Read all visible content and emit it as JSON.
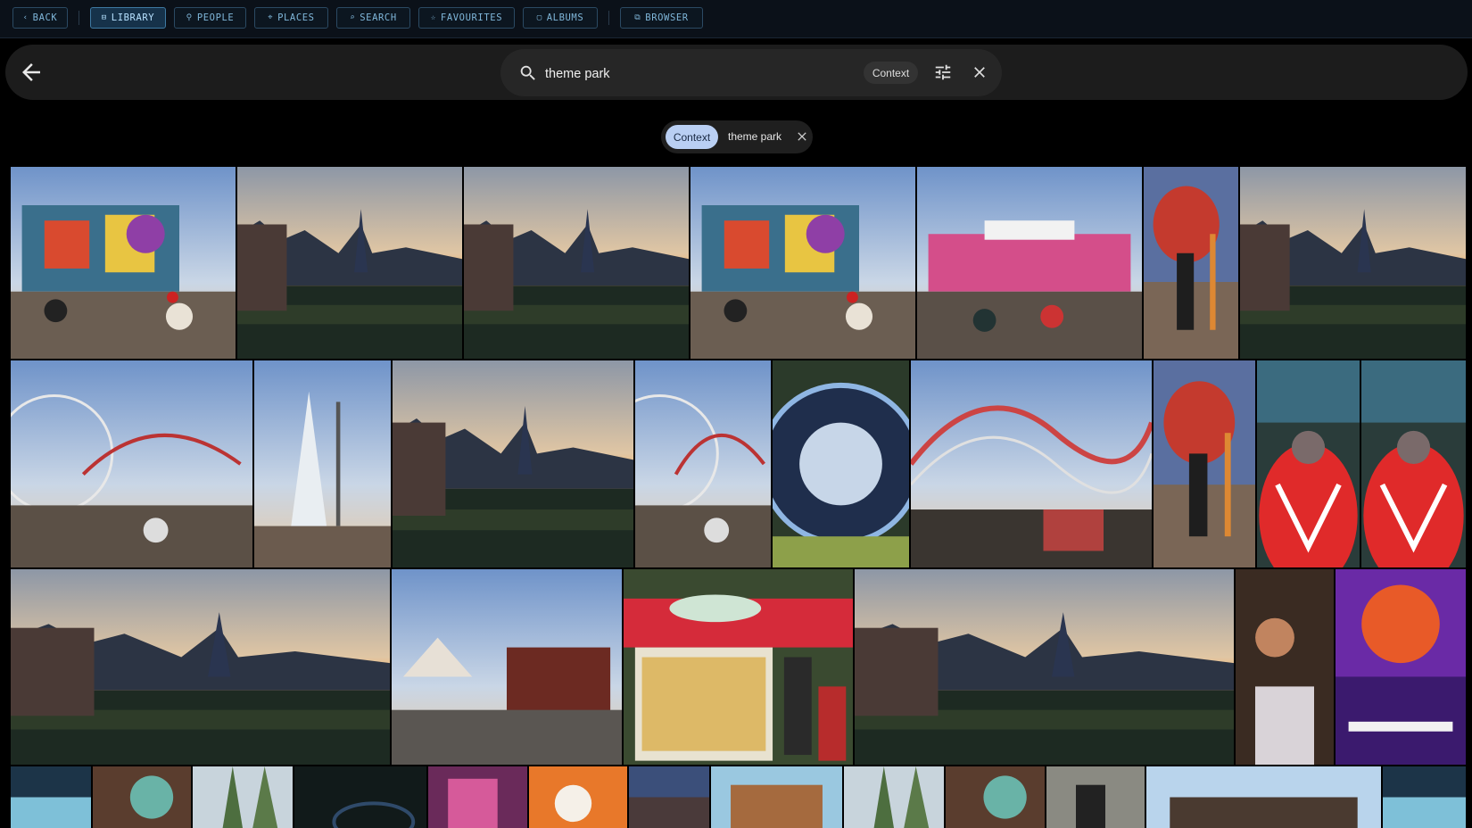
{
  "nav": {
    "buttons": [
      {
        "label": "BACK",
        "icon": "chevron-left-icon",
        "active": false
      },
      {
        "label": "LIBRARY",
        "icon": "library-icon",
        "active": true
      },
      {
        "label": "PEOPLE",
        "icon": "person-icon",
        "active": false
      },
      {
        "label": "PLACES",
        "icon": "pin-icon",
        "active": false
      },
      {
        "label": "SEARCH",
        "icon": "search-icon",
        "active": false
      },
      {
        "label": "FAVOURITES",
        "icon": "star-icon",
        "active": false
      },
      {
        "label": "ALBUMS",
        "icon": "album-icon",
        "active": false
      },
      {
        "label": "BROWSER",
        "icon": "external-link-icon",
        "active": false
      }
    ],
    "glyphs": [
      "‹",
      "⊟",
      "⚲",
      "⌖",
      "⌕",
      "☆",
      "▢",
      "⧉"
    ]
  },
  "search": {
    "query": "theme park",
    "context_label": "Context",
    "icons": [
      "back-arrow-icon",
      "search-icon",
      "tune-icon",
      "close-icon"
    ]
  },
  "filter": {
    "context_label": "Context",
    "term": "theme park",
    "remove_icon": "close-icon"
  },
  "colors": {
    "nav_bg": "#0b1119",
    "nav_accent": "#7fb6d9",
    "search_bg": "#1c1c1c",
    "chip_active": "#b9cff3",
    "page_bg": "#000000"
  },
  "photos": [
    {
      "subject": "fairground"
    },
    {
      "subject": "castle-lake"
    },
    {
      "subject": "castle-lake"
    },
    {
      "subject": "fairground"
    },
    {
      "subject": "fairground-ride"
    },
    {
      "subject": "person-figure"
    },
    {
      "subject": "castle-lake"
    },
    {
      "subject": "ferris-coaster"
    },
    {
      "subject": "tower"
    },
    {
      "subject": "castle-lake"
    },
    {
      "subject": "ferris-coaster"
    },
    {
      "subject": "blur-ride"
    },
    {
      "subject": "rollercoaster"
    },
    {
      "subject": "person-figure"
    },
    {
      "subject": "red-car"
    },
    {
      "subject": "red-car"
    },
    {
      "subject": "castle-lake"
    },
    {
      "subject": "circus"
    },
    {
      "subject": "shop"
    },
    {
      "subject": "castle-lake"
    },
    {
      "subject": "dark-people"
    },
    {
      "subject": "neon-sign"
    },
    {
      "subject": "poster"
    },
    {
      "subject": "figure"
    },
    {
      "subject": "trees"
    },
    {
      "subject": "dark"
    },
    {
      "subject": "toys"
    },
    {
      "subject": "orange"
    },
    {
      "subject": "crowd"
    },
    {
      "subject": "sign"
    },
    {
      "subject": "trees"
    },
    {
      "subject": "figure"
    },
    {
      "subject": "stone"
    },
    {
      "subject": "building"
    },
    {
      "subject": "poster"
    }
  ]
}
